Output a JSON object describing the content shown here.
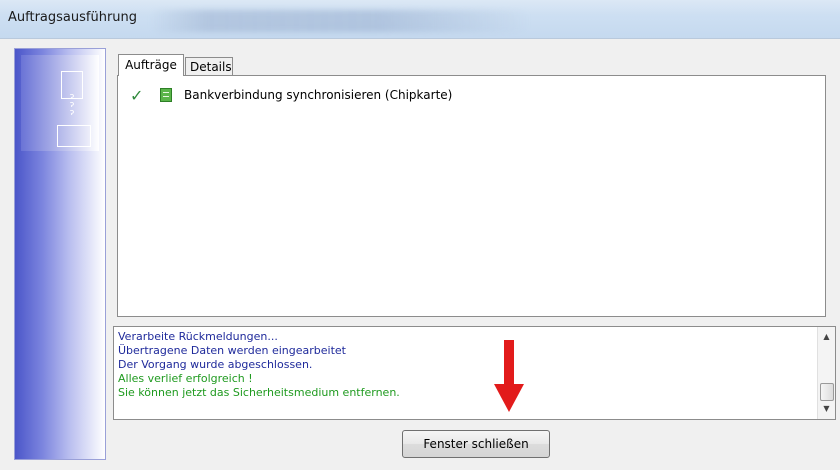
{
  "window": {
    "title": "Auftragsausführung"
  },
  "tabs": [
    {
      "label": "Aufträge",
      "active": true
    },
    {
      "label": "Details",
      "active": false
    }
  ],
  "tasks": [
    {
      "label": "Bankverbindung synchronisieren (Chipkarte)",
      "status": "checkmark-icon",
      "type": "document-icon"
    }
  ],
  "log": {
    "lines": [
      {
        "text": "Verarbeite Rückmeldungen...",
        "color": "#1f2a9b"
      },
      {
        "text": "Übertragene Daten werden eingearbeitet",
        "color": "#1f2a9b"
      },
      {
        "text": "Der Vorgang wurde abgeschlossen.",
        "color": "#1f2a9b"
      },
      {
        "text": "Alles verlief erfolgreich !",
        "color": "#1f9a1f"
      },
      {
        "text": "Sie können jetzt das Sicherheitsmedium entfernen.",
        "color": "#1f9a1f"
      }
    ]
  },
  "buttons": {
    "close_label": "Fenster schließen"
  },
  "annotation": {
    "arrow_color": "#e21b1b"
  }
}
